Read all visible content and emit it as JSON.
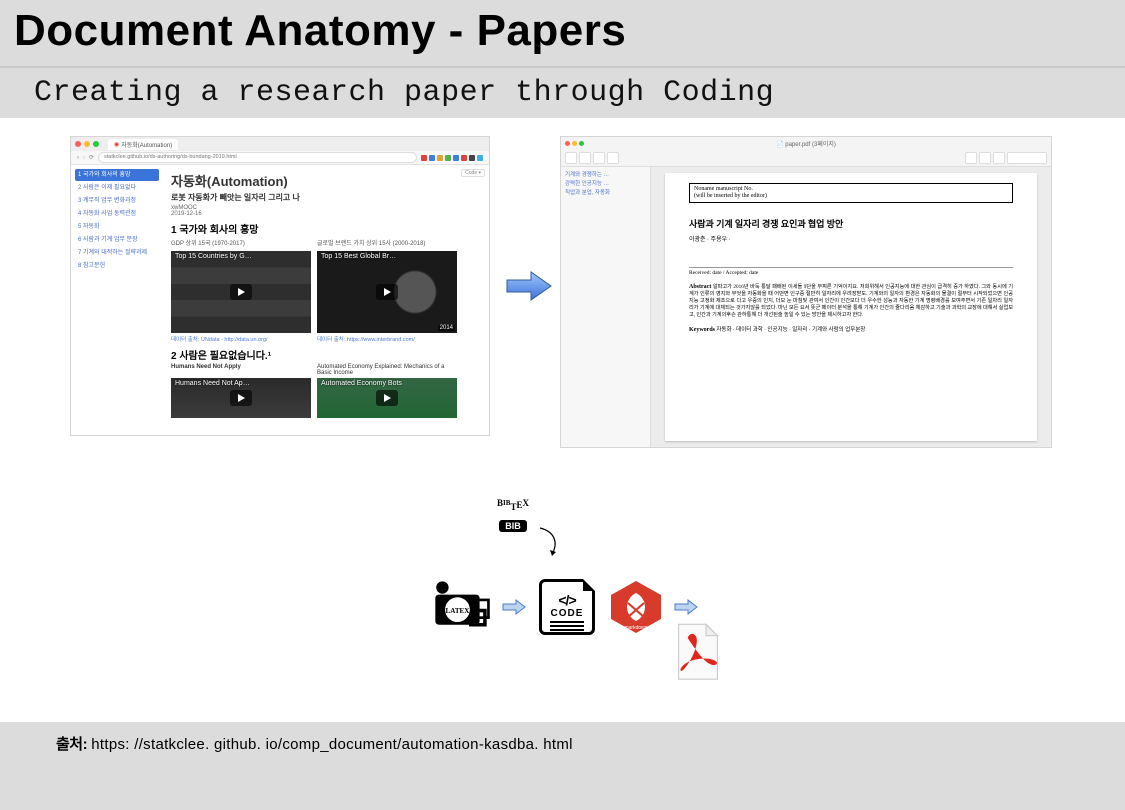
{
  "slide": {
    "title": "Document Anatomy - Papers",
    "subtitle": "Creating a research paper through Coding"
  },
  "browser": {
    "tab": "자동화(Automation)",
    "url": "statkclee.github.io/ds-authoring/ds-bundang-2019.html",
    "code_btn": "Code ▾",
    "toc": [
      {
        "text": "1 국가와 회사의 흥망",
        "active": true
      },
      {
        "text": "2 사람은 이제 필요없다",
        "active": false
      },
      {
        "text": "3 계무직 업무 변화과정",
        "active": false
      },
      {
        "text": "4 자동화 사업 동력관점",
        "active": false
      },
      {
        "text": "5 자동화",
        "active": false
      },
      {
        "text": "6 사람과 기계 업무 분장",
        "active": false
      },
      {
        "text": "7 기계와 대적하는 절략과제",
        "active": false
      },
      {
        "text": "8 참고문헌",
        "active": false
      }
    ],
    "h1": "자동화(Automation)",
    "h2": "로봇 자동화가 빼앗는 일자리 그리고 나",
    "author": "xwMOOC",
    "date": "2019-12-16",
    "sec1": "1 국가와 회사의 흥망",
    "sub1a": "GDP 상위 15국 (1970-2017)",
    "sub1b": "글로벌 브랜드 가치 상위 15사 (2000-2018)",
    "v1": "Top 15 Countries by G…",
    "v2": "Top 15 Best Global Br…",
    "v2badge": "2014",
    "src1": "데이터 출처: UNdata - http://data.un.org/",
    "src2": "데이터 출처: https://www.interbrand.com/",
    "sec2": "2 사람은 필요없습니다.¹",
    "sub2a": "Humans Need Not Apply",
    "sub2b": "Automated Economy Explained: Mechanics of a Basic Income",
    "v3": "Humans Need Not Ap…",
    "v4": "Automated Economy Bots"
  },
  "pdf": {
    "titlebar": "📄  paper.pdf (3페이지)",
    "toc": [
      "기계와 경쟁하는 …",
      "강력한 인공지능 …",
      "직업과 분업, 자동화"
    ],
    "hdr_l1": "Noname manuscript No.",
    "hdr_l2": "(will be inserted by the editor)",
    "title": "사람과 기계 일자리 경쟁 요인과 협업 방안",
    "authors": "이광춘 · 주용우 ·",
    "received": "Received: date / Accepted: date",
    "abs_label": "Abstract",
    "abstract": "알파고가 2016년 바둑 통달 패배된 이세돌 9단을 무찌른 기억이지요. 저희위해서 인공지능에 대한 관심이 급격히 증가 하였다. 그와 동시에 기계가 인류의 영지와 무엇을 자동화을 때 어떤면 인구중 절반히 일자리에 우려장받도. 기계와의 일자의 환경은 자동화의 물결이 절부터 시작되었으면 인공지능 고정화 제조으로 다고 우중의 인지, 더모 눈 마침및 관여서 인간이 인간모다 더 우수한 성능과 자동한 기계 명령배경를 보여주면서 기존 일차리 일자리가 기계에 대체되는 것가지않를 되었다. 마닌 모든 요서 뜻군 페이터 분석을 통해 기계가 인간의 줄다리움 체감하고 기술과 과학의 교장에 대해서 실업보고, 인간과 기계의후손 관하통해 더 개선된술 높일 수 있는 방안을 제시하고자 한다.",
    "kw_label": "Keywords",
    "keywords": "자동화 · 데이터 과학 · 인공지능 · 일자리 · 기계와 사람의 업무분장"
  },
  "pipeline": {
    "bib": "BIB",
    "bibtex": "BIB\nTEX",
    "code_label": "CODE",
    "md_label": "markdown"
  },
  "source": {
    "label": "출처:",
    "url": "https: //statkclee. github. io/comp_document/automation-kasdba. html"
  }
}
